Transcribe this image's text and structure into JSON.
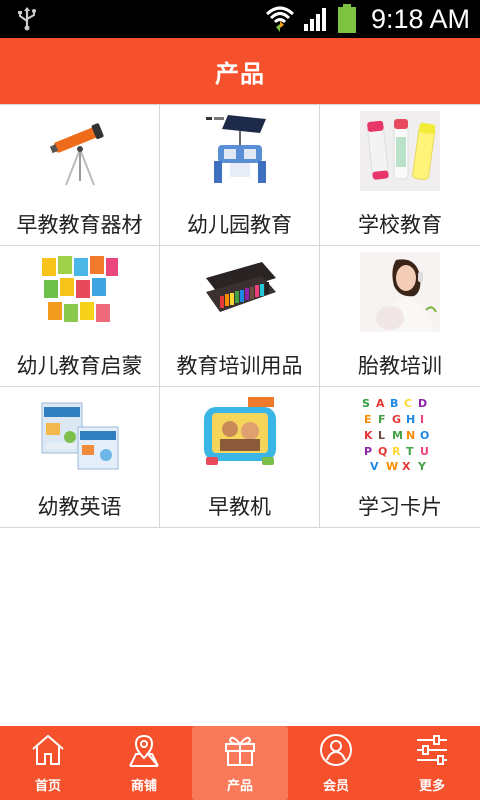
{
  "status_bar": {
    "time": "9:18 AM"
  },
  "header": {
    "title": "产品"
  },
  "products": [
    {
      "label": "早教教育器材",
      "icon": "telescope-product-image"
    },
    {
      "label": "幼儿园教育",
      "icon": "solar-robot-product-image"
    },
    {
      "label": "学校教育",
      "icon": "glue-sticks-product-image"
    },
    {
      "label": "幼儿教育启蒙",
      "icon": "picture-books-product-image"
    },
    {
      "label": "教育培训用品",
      "icon": "paint-set-product-image"
    },
    {
      "label": "胎教培训",
      "icon": "pregnant-woman-product-image"
    },
    {
      "label": "幼教英语",
      "icon": "english-books-product-image"
    },
    {
      "label": "早教机",
      "icon": "learning-tablet-product-image"
    },
    {
      "label": "学习卡片",
      "icon": "alphabet-puzzle-product-image"
    }
  ],
  "tabs": [
    {
      "label": "首页",
      "icon": "home-icon"
    },
    {
      "label": "商铺",
      "icon": "map-pin-icon"
    },
    {
      "label": "产品",
      "icon": "gift-icon",
      "active": true
    },
    {
      "label": "会员",
      "icon": "user-icon"
    },
    {
      "label": "更多",
      "icon": "sliders-icon"
    }
  ],
  "colors": {
    "accent": "#f4512c",
    "active_tab": "#f97a5a"
  }
}
